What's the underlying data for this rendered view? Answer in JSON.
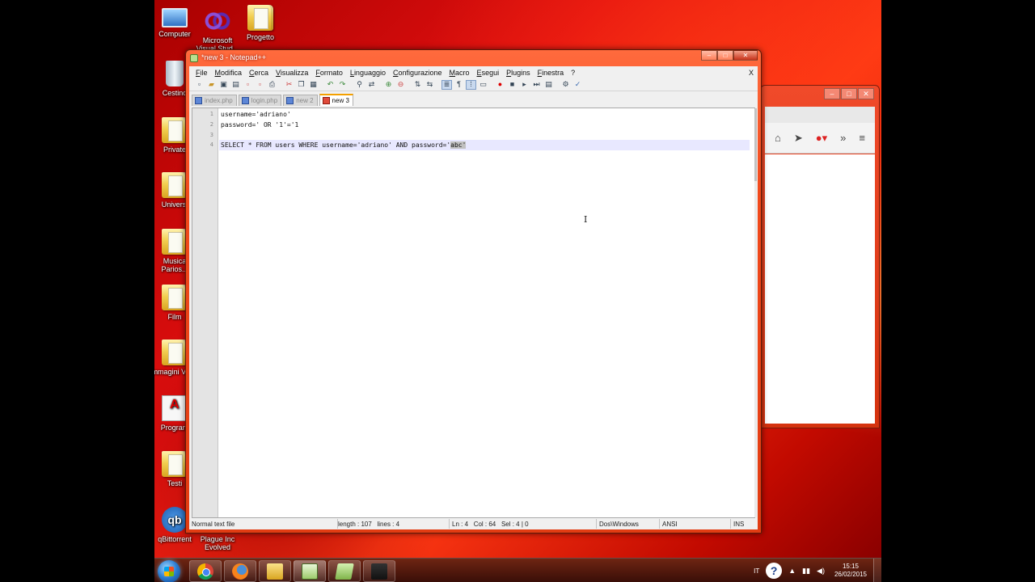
{
  "desktop": {
    "icons": [
      {
        "label": "Computer",
        "kind": "computer-icon"
      },
      {
        "label": "Microsoft Visual Stud...",
        "kind": "visual-studio-icon"
      },
      {
        "label": "Progetto",
        "kind": "folder-icon"
      },
      {
        "label": "Cestino",
        "kind": "recycle-bin-icon"
      },
      {
        "label": "Private",
        "kind": "folder-icon"
      },
      {
        "label": "Universi",
        "kind": "folder-icon"
      },
      {
        "label": "Musica Parios...",
        "kind": "folder-icon"
      },
      {
        "label": "Film",
        "kind": "folder-icon"
      },
      {
        "label": "Immagini Video",
        "kind": "folder-icon"
      },
      {
        "label": "Program",
        "kind": "pdf-icon"
      },
      {
        "label": "Testi",
        "kind": "folder-icon"
      },
      {
        "label": "qBittorrent",
        "kind": "qbittorrent-icon"
      },
      {
        "label": "Plague Inc Evolved",
        "kind": "game-icon"
      }
    ]
  },
  "npp": {
    "title": "*new 3 - Notepad++",
    "menu": [
      "File",
      "Modifica",
      "Cerca",
      "Visualizza",
      "Formato",
      "Linguaggio",
      "Configurazione",
      "Macro",
      "Esegui",
      "Plugins",
      "Finestra",
      "?"
    ],
    "menu_close": "X",
    "tabs": [
      {
        "label": "index.php",
        "active": false
      },
      {
        "label": "login.php",
        "active": false
      },
      {
        "label": "new 2",
        "active": false
      },
      {
        "label": "new 3",
        "active": true
      }
    ],
    "lines": [
      {
        "num": "1",
        "pre": "username='adriano'",
        "sel": "",
        "post": ""
      },
      {
        "num": "2",
        "pre": "password=' OR '1'='1",
        "sel": "",
        "post": ""
      },
      {
        "num": "3",
        "pre": "",
        "sel": "",
        "post": ""
      },
      {
        "num": "4",
        "pre": "SELECT * FROM users WHERE username='adriano' AND password='",
        "sel": "abc'",
        "post": ""
      }
    ],
    "status": {
      "type": "Normal text file",
      "length": "length : 107",
      "lines": "lines : 4",
      "ln": "Ln : 4",
      "col": "Col : 64",
      "sel": "Sel : 4 | 0",
      "eol": "Dos\\Windows",
      "encoding": "ANSI",
      "mode": "INS"
    }
  },
  "taskbar": {
    "language": "IT",
    "time": "15:15",
    "date": "26/02/2015"
  }
}
